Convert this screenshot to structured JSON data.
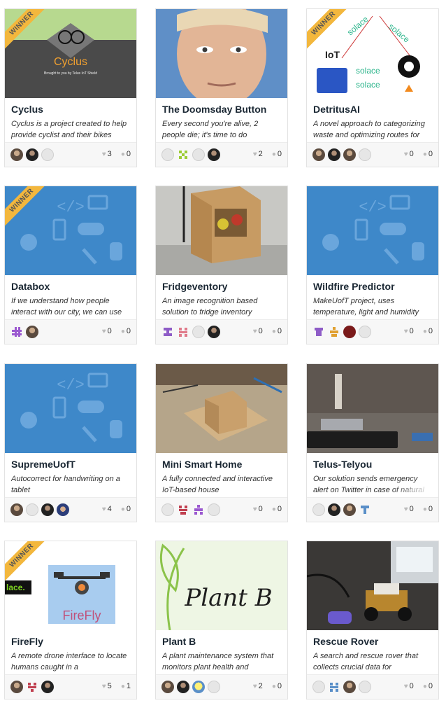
{
  "ribbon_label": "WINNER",
  "projects": [
    {
      "title": "Cyclus",
      "desc": "Cyclus is a project created to help provide cyclist and their bikes",
      "likes": "3",
      "comments": "0",
      "winner": true,
      "thumb_text": "Cyclus",
      "thumb_sub": "Brought to you by Telus IoT Shield"
    },
    {
      "title": "The Doomsday Button",
      "desc": "Every second you're alive, 2 people die; it's time to do",
      "likes": "2",
      "comments": "0",
      "winner": false
    },
    {
      "title": "DetritusAI",
      "desc": "A novel approach to categorizing waste and optimizing routes for",
      "likes": "0",
      "comments": "0",
      "winner": true,
      "thumb_solace": "solace",
      "thumb_iot": "IoT"
    },
    {
      "title": "Databox",
      "desc": "If we understand how people interact with our city, we can use",
      "likes": "0",
      "comments": "0",
      "winner": true
    },
    {
      "title": "Fridgeventory",
      "desc": "An image recognition based solution to fridge inventory",
      "likes": "0",
      "comments": "0",
      "winner": false
    },
    {
      "title": "Wildfire Predictor",
      "desc": "MakeUofT project, uses temperature, light and humidity",
      "likes": "0",
      "comments": "0",
      "winner": false
    },
    {
      "title": "SupremeUofT",
      "desc": "Autocorrect for handwriting on a tablet",
      "likes": "4",
      "comments": "0",
      "winner": false
    },
    {
      "title": "Mini Smart Home",
      "desc": "A fully connected and interactive IoT-based house",
      "likes": "0",
      "comments": "0",
      "winner": false
    },
    {
      "title": "Telus-Telyou",
      "desc": "Our solution sends emergency alert on Twitter in case of natural",
      "likes": "0",
      "comments": "0",
      "winner": false
    },
    {
      "title": "FireFly",
      "desc": "A remote drone interface to locate humans caught in a",
      "likes": "5",
      "comments": "1",
      "winner": true,
      "thumb_text": "FireFly",
      "thumb_side": "lace."
    },
    {
      "title": "Plant B",
      "desc": "A plant maintenance system that monitors plant health and",
      "likes": "2",
      "comments": "0",
      "winner": false,
      "thumb_text": "Plant B"
    },
    {
      "title": "Rescue Rover",
      "desc": "A search and rescue rover that collects crucial data for",
      "likes": "0",
      "comments": "0",
      "winner": false
    }
  ],
  "icons": {
    "like": "heart-icon",
    "comment": "speech-bubble-icon"
  },
  "colors": {
    "title": "#1a2733",
    "ribbon": "#f3b73d",
    "placeholder_blue": "#3e88c9",
    "footer_bg": "#f7f7f7"
  }
}
